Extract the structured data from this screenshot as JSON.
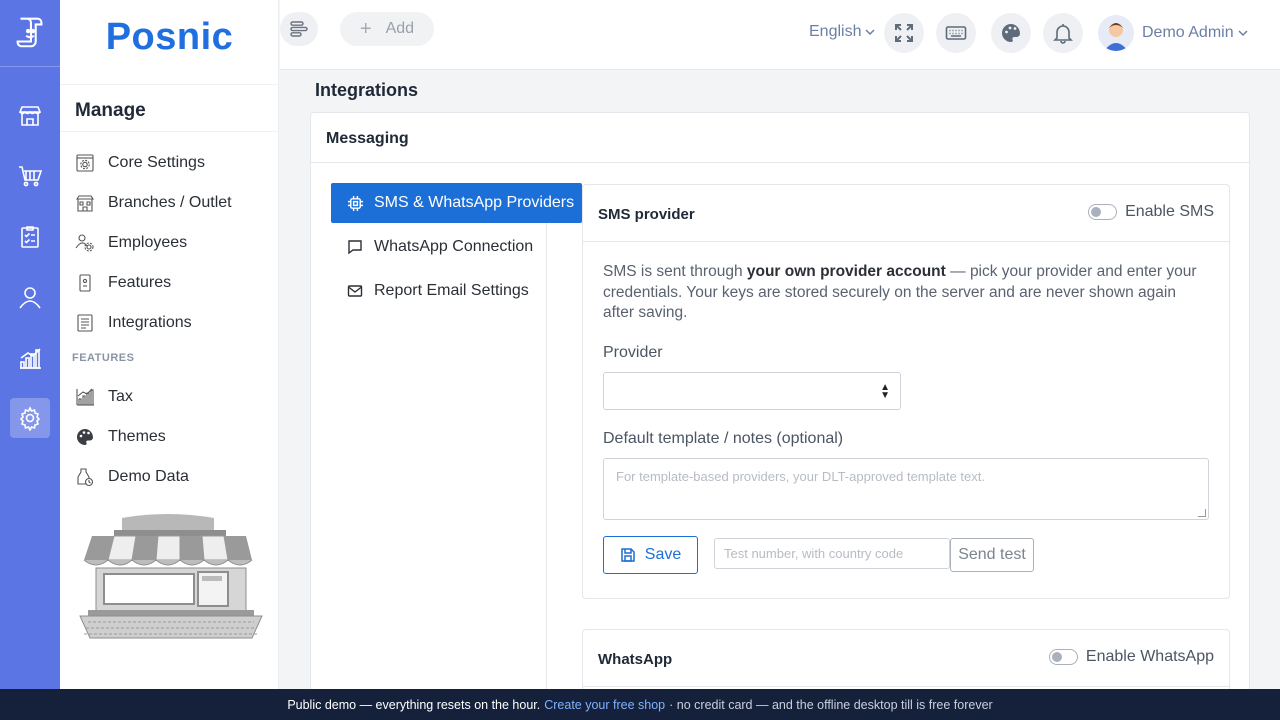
{
  "brand": {
    "name": "Posnic"
  },
  "rail": {
    "items": [
      {
        "icon": "store-icon"
      },
      {
        "icon": "cart-icon"
      },
      {
        "icon": "clipboard-icon"
      },
      {
        "icon": "user-icon"
      },
      {
        "icon": "chart-icon"
      },
      {
        "icon": "gear-icon",
        "active": true
      }
    ]
  },
  "sidebar": {
    "section_title": "Manage",
    "items": [
      {
        "label": "Core Settings",
        "icon": "settings-doc-icon"
      },
      {
        "label": "Branches / Outlet",
        "icon": "building-icon"
      },
      {
        "label": "Employees",
        "icon": "employees-icon"
      },
      {
        "label": "Features",
        "icon": "features-icon"
      },
      {
        "label": "Integrations",
        "icon": "integrations-icon"
      }
    ],
    "features_heading": "FEATURES",
    "feature_items": [
      {
        "label": "Tax",
        "icon": "tax-icon"
      },
      {
        "label": "Themes",
        "icon": "palette-icon"
      },
      {
        "label": "Demo Data",
        "icon": "demo-data-icon"
      }
    ]
  },
  "topbar": {
    "add_label": "Add",
    "language": "English",
    "user_name": "Demo Admin"
  },
  "page": {
    "title": "Integrations",
    "card_title": "Messaging",
    "tabs": [
      {
        "label": "SMS & WhatsApp Providers",
        "active": true
      },
      {
        "label": "WhatsApp Connection",
        "active": false
      },
      {
        "label": "Report Email Settings",
        "active": false
      }
    ]
  },
  "sms": {
    "title": "SMS provider",
    "toggle_label": "Enable SMS",
    "desc_pre": "SMS is sent through ",
    "desc_bold": "your own provider account",
    "desc_post": " — pick your provider and enter your credentials. Your keys are stored securely on the server and are never shown again after saving.",
    "provider_label": "Provider",
    "provider_value": "",
    "template_label": "Default template / notes (optional)",
    "template_placeholder": "For template-based providers, your DLT-approved template text.",
    "save_label": "Save",
    "test_placeholder": "Test number, with country code",
    "test_button": "Send test"
  },
  "whatsapp": {
    "title": "WhatsApp",
    "toggle_label": "Enable WhatsApp"
  },
  "footer": {
    "text": "Public demo — everything resets on the hour.",
    "link": "Create your free shop",
    "rest": "· no credit card — and the offline desktop till is free forever"
  },
  "colors": {
    "rail": "#5b75e4",
    "brand": "#1f6fe0",
    "accent": "#1c6fd6",
    "footer_bg": "#15213b",
    "footer_link": "#7fb1ff"
  }
}
